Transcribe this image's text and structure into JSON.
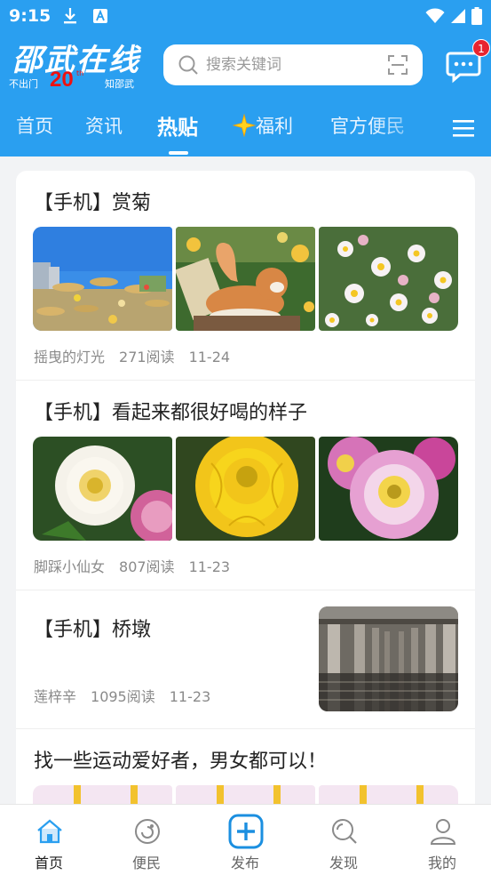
{
  "status_bar": {
    "time": "9:15"
  },
  "header": {
    "logo_title": "邵武在线",
    "logo_left": "不出门",
    "logo_20": "20",
    "logo_th": "th",
    "logo_right": "知邵武",
    "search_placeholder": "搜索关键词",
    "message_badge": "1"
  },
  "tabs": [
    {
      "label": "首页"
    },
    {
      "label": "资讯"
    },
    {
      "label": "热贴",
      "active": true
    },
    {
      "label": "福利",
      "icon": "sparkle-icon"
    },
    {
      "label": "官方便民"
    }
  ],
  "posts": [
    {
      "title": "【手机】赏菊",
      "author": "摇曳的灯光",
      "reads": "271阅读",
      "date": "11-24",
      "images": 3
    },
    {
      "title": "【手机】看起来都很好喝的样子",
      "author": "脚踩小仙女",
      "reads": "807阅读",
      "date": "11-23",
      "images": 3
    },
    {
      "title": "【手机】桥墩",
      "author": "莲梓辛",
      "reads": "1095阅读",
      "date": "11-23",
      "images": 1
    },
    {
      "title": "找一些运动爱好者，男女都可以！",
      "images": 3
    }
  ],
  "bottom_nav": [
    {
      "label": "首页",
      "icon": "home-icon",
      "active": true
    },
    {
      "label": "便民",
      "icon": "service-icon"
    },
    {
      "label": "发布",
      "icon": "publish-plus-icon"
    },
    {
      "label": "发现",
      "icon": "discover-search-icon"
    },
    {
      "label": "我的",
      "icon": "profile-icon"
    }
  ],
  "colors": {
    "brand_blue": "#2a9ff0",
    "badge_red": "#e8242f",
    "accent": "#1b8fe0"
  }
}
